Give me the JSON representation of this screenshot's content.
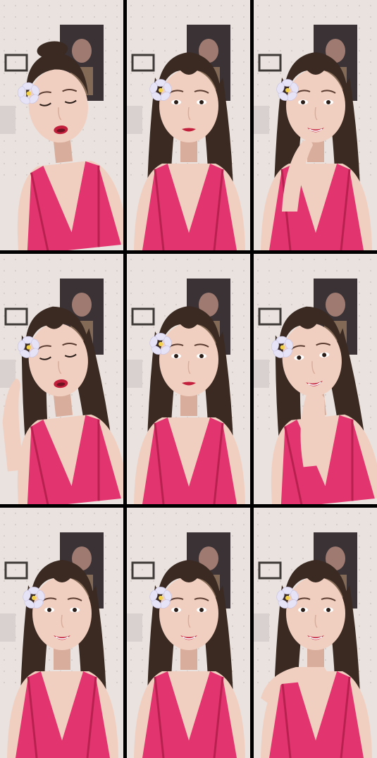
{
  "layout": {
    "columns": 3,
    "rows": 3
  },
  "frames": [
    {
      "id": "frame-1",
      "eyes": "closed",
      "mouth": "open",
      "hand": "none",
      "variant": "tilt-left",
      "hair": "up"
    },
    {
      "id": "frame-2",
      "eyes": "open",
      "mouth": "closed",
      "hand": "none",
      "variant": "center",
      "hair": "long"
    },
    {
      "id": "frame-3",
      "eyes": "open",
      "mouth": "smile",
      "hand": "chin",
      "variant": "center",
      "hair": "long"
    },
    {
      "id": "frame-4",
      "eyes": "closed",
      "mouth": "open",
      "hand": "wave",
      "variant": "tilt-left",
      "hair": "long"
    },
    {
      "id": "frame-5",
      "eyes": "open",
      "mouth": "closed",
      "hand": "none",
      "variant": "center",
      "hair": "long"
    },
    {
      "id": "frame-6",
      "eyes": "open",
      "mouth": "smile",
      "hand": "face",
      "variant": "tilt-left",
      "hair": "long"
    },
    {
      "id": "frame-7",
      "eyes": "open",
      "mouth": "smile",
      "hand": "none",
      "variant": "center",
      "hair": "long"
    },
    {
      "id": "frame-8",
      "eyes": "open",
      "mouth": "smile",
      "hand": "none",
      "variant": "center",
      "hair": "long"
    },
    {
      "id": "frame-9",
      "eyes": "open",
      "mouth": "smile",
      "hand": "chin-flat",
      "variant": "center",
      "hair": "long"
    }
  ],
  "colors": {
    "grid_gap": "#000000",
    "wall": "#e9e2de",
    "wall_dots": "#c9b9b6",
    "skin": "#f1cfc0",
    "skin_shadow": "#d9ad9c",
    "hair": "#3a2a22",
    "dress": "#e2356f",
    "dress_shadow": "#b8214f",
    "lips": "#c21f3c",
    "flower": "#e6e3f7",
    "flower_center": "#f2d24b",
    "poster": "#3a3235",
    "poster_accent": "#c9a27a",
    "frame_box": "#3f3a38"
  }
}
